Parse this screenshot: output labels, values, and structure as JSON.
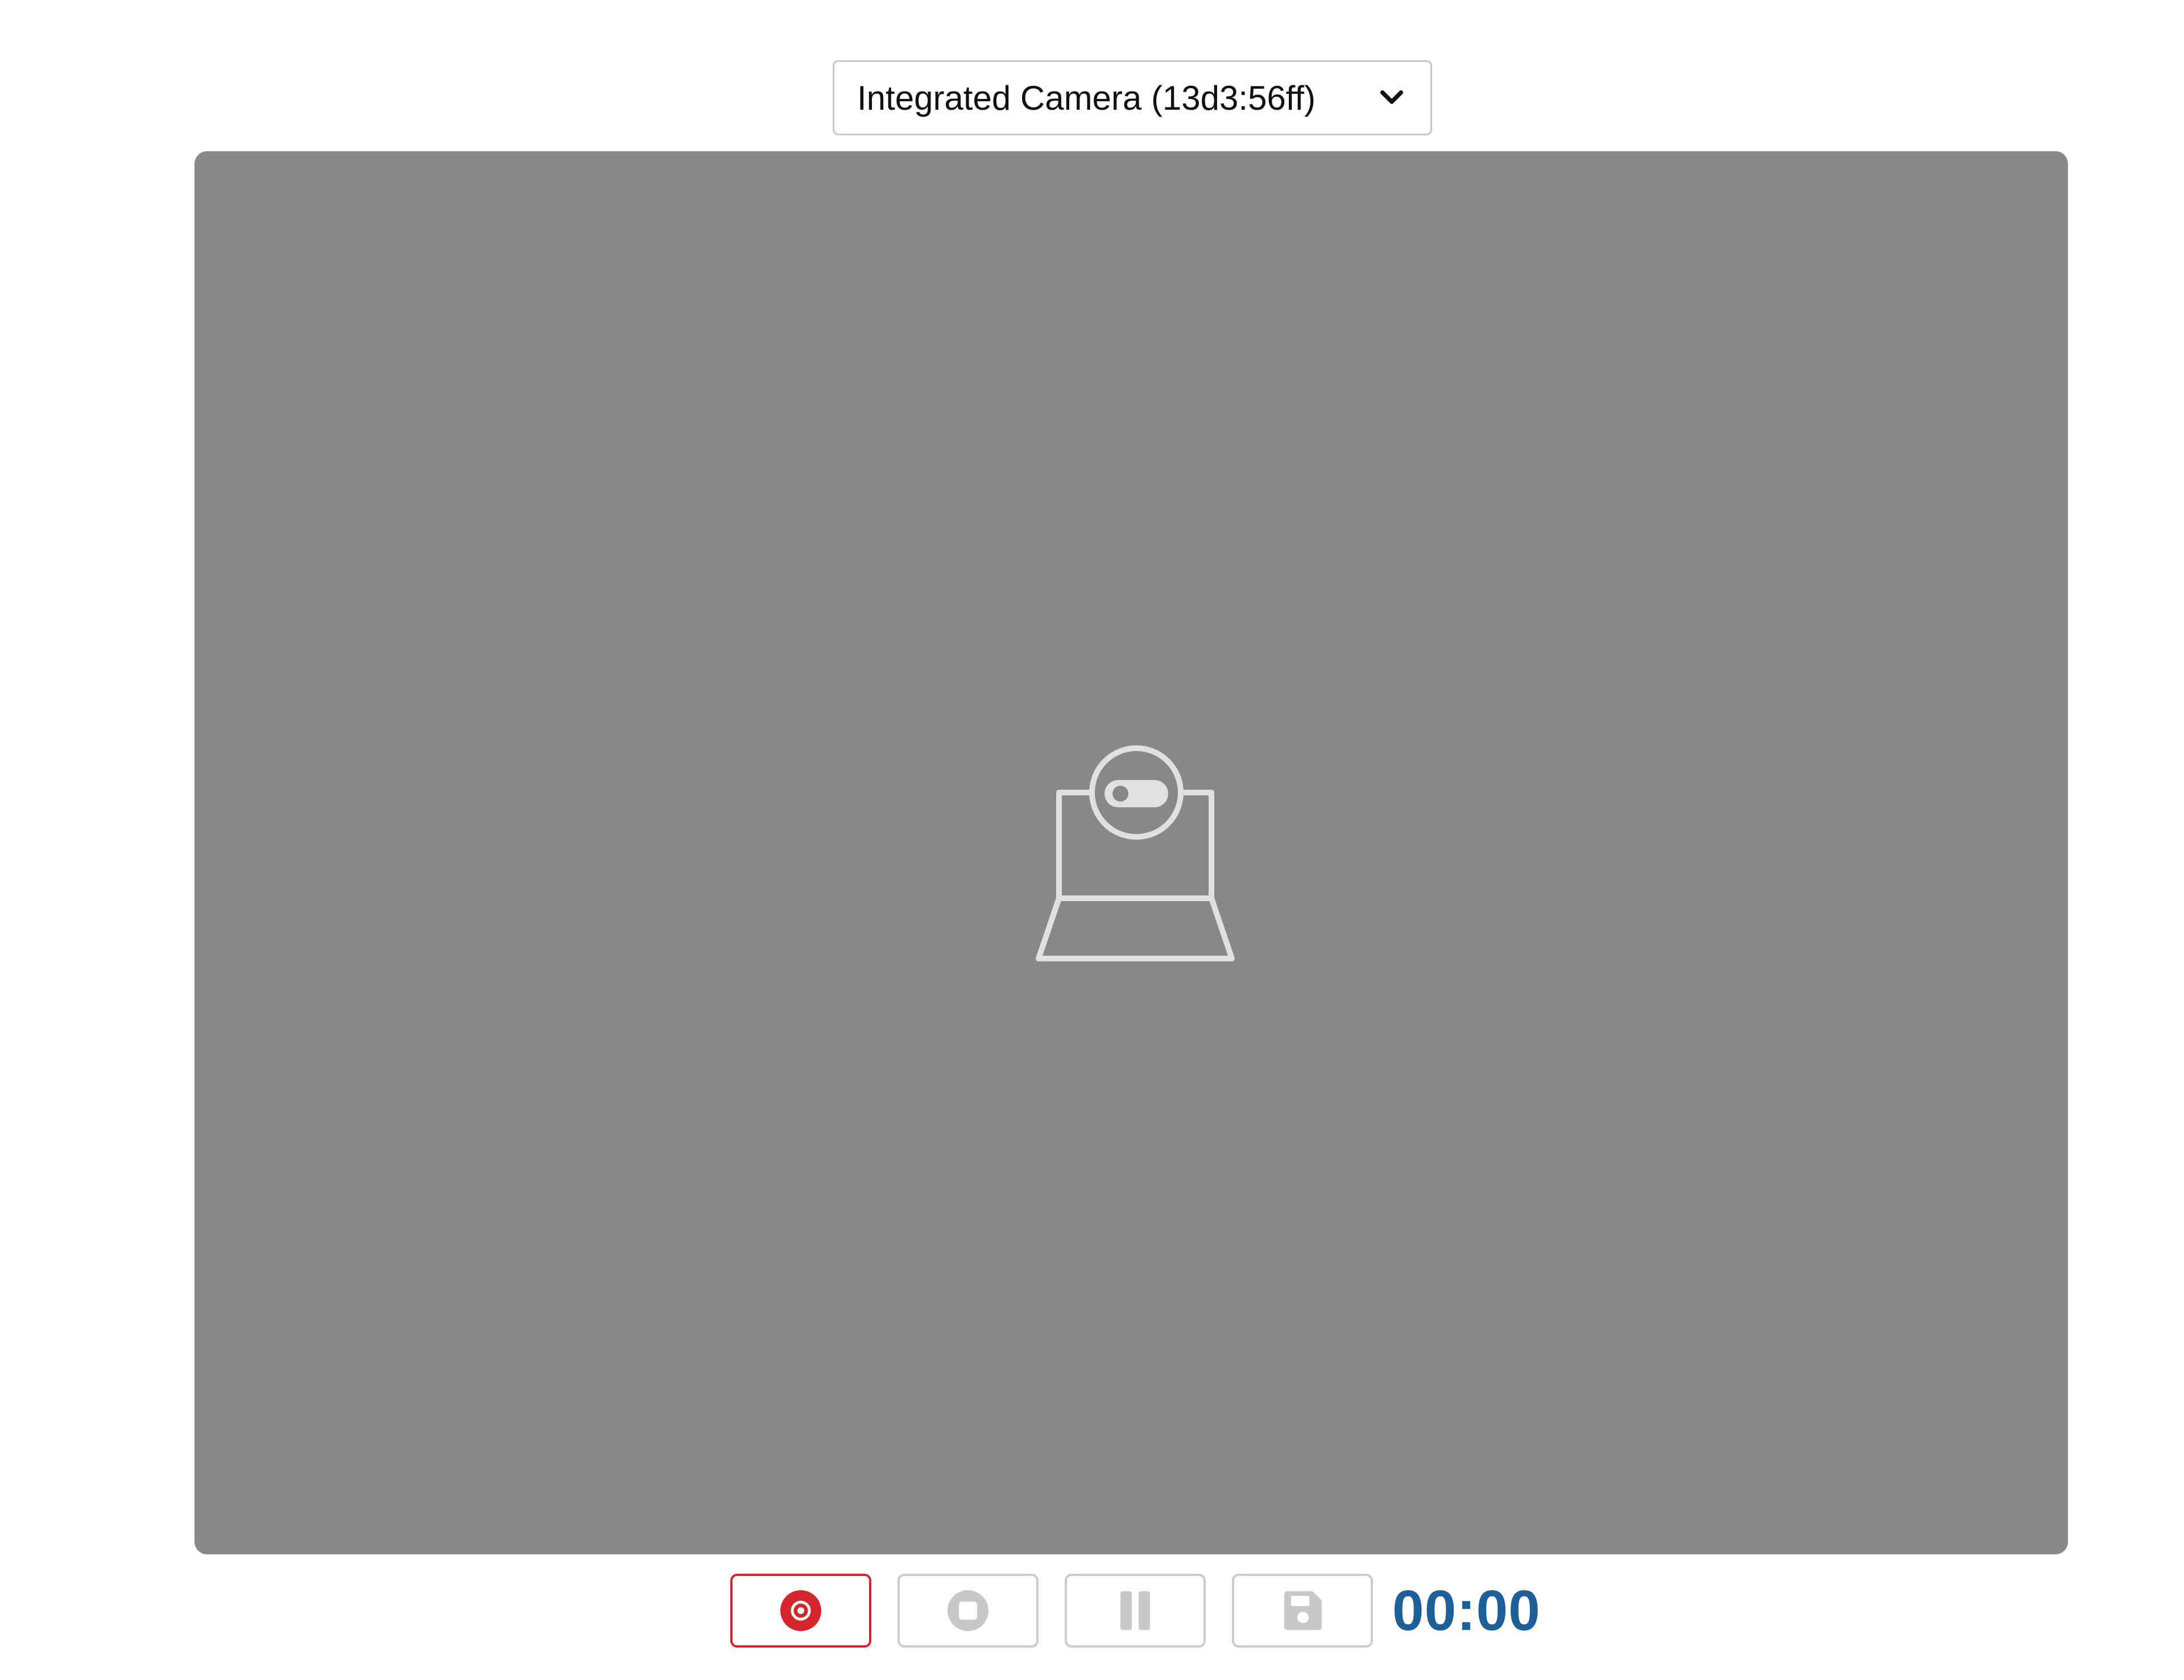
{
  "camera_select": {
    "selected": "Integrated Camera (13d3:56ff)",
    "icon": "chevron-down-icon"
  },
  "video_preview": {
    "background_color": "#88888a",
    "icon": "webcam-icon"
  },
  "controls": {
    "record_icon": "record-icon",
    "stop_icon": "stop-icon",
    "pause_icon": "pause-icon",
    "save_icon": "save-icon",
    "record_color": "#d4262c",
    "disabled_color": "#c8c8c8",
    "timer": "00:00",
    "timer_color": "#1f5f99"
  }
}
